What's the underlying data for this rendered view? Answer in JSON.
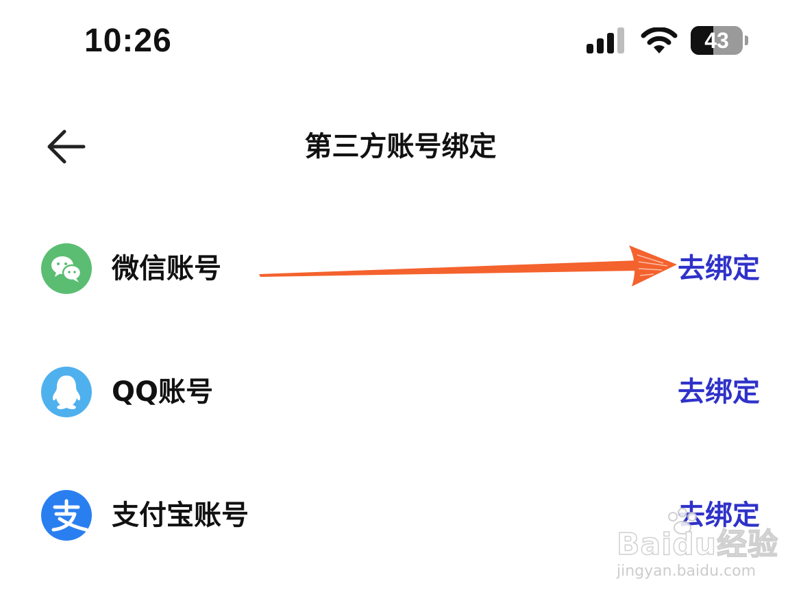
{
  "status_bar": {
    "time": "10:26",
    "signal_icon": "cellular-signal-icon",
    "wifi_icon": "wifi-icon",
    "battery_level": "43",
    "battery_fraction": 0.43
  },
  "nav": {
    "back_icon": "arrow-left-icon",
    "title": "第三方账号绑定"
  },
  "accounts": [
    {
      "label": "微信账号",
      "action": "去绑定",
      "icon": "wechat-icon",
      "icon_color": "#5bbd72"
    },
    {
      "label": "QQ账号",
      "action": "去绑定",
      "icon": "qq-penguin-icon",
      "icon_color": "#4fb0ee"
    },
    {
      "label": "支付宝账号",
      "action": "去绑定",
      "icon": "alipay-icon",
      "icon_color": "#2a7ff0"
    }
  ],
  "annotation": {
    "arrow_color": "#f4622d"
  },
  "watermark": {
    "brand": "Baidu经验",
    "url": "jingyan.baidu.com"
  },
  "colors": {
    "link": "#2f32c9",
    "text": "#111111",
    "background": "#ffffff"
  }
}
